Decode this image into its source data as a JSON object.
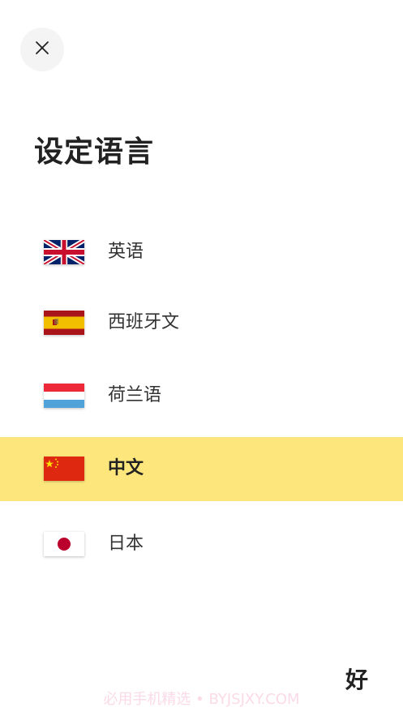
{
  "title": "设定语言",
  "languages": [
    {
      "label": "英语",
      "flag": "uk-flag-icon",
      "selected": false
    },
    {
      "label": "西班牙文",
      "flag": "spain-flag-icon",
      "selected": false
    },
    {
      "label": "荷兰语",
      "flag": "luxembourg-flag-icon",
      "selected": false
    },
    {
      "label": "中文",
      "flag": "china-flag-icon",
      "selected": true
    },
    {
      "label": "日本",
      "flag": "japan-flag-icon",
      "selected": false
    }
  ],
  "ok_label": "好",
  "watermark": "必用手机精选 • BYJSJXY.COM",
  "colors": {
    "highlight": "#fde77d",
    "close_bg": "#f4f4f4"
  }
}
